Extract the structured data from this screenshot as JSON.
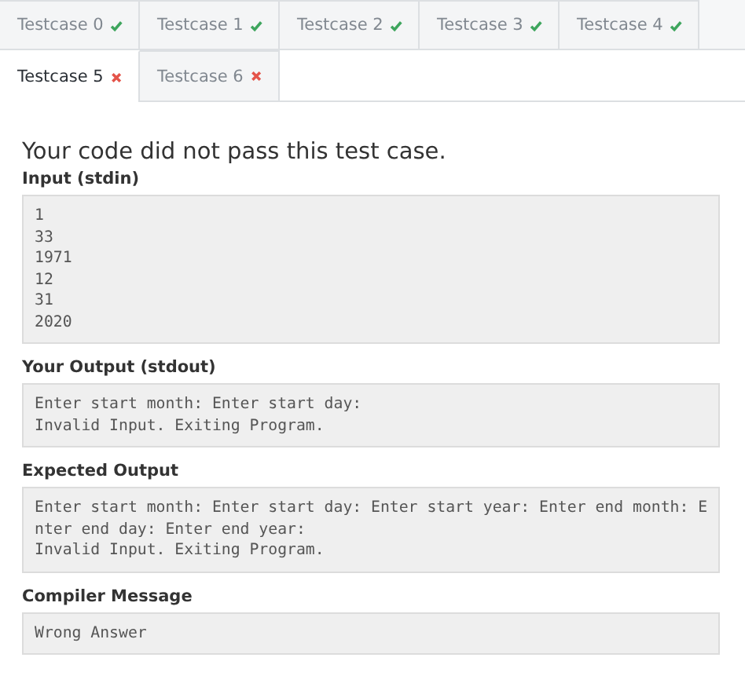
{
  "tabs": [
    {
      "label": "Testcase 0",
      "passed": true,
      "selected": false
    },
    {
      "label": "Testcase 1",
      "passed": true,
      "selected": false
    },
    {
      "label": "Testcase 2",
      "passed": true,
      "selected": false
    },
    {
      "label": "Testcase 3",
      "passed": true,
      "selected": false
    },
    {
      "label": "Testcase 4",
      "passed": true,
      "selected": false
    },
    {
      "label": "Testcase 5",
      "passed": false,
      "selected": true
    },
    {
      "label": "Testcase 6",
      "passed": false,
      "selected": false
    }
  ],
  "result_message": "Your code did not pass this test case.",
  "sections": [
    {
      "title": "Input (stdin)",
      "lines": [
        "1",
        "33",
        "1971",
        "12",
        "31",
        "2020"
      ]
    },
    {
      "title": "Your Output (stdout)",
      "lines": [
        "Enter start month: Enter start day:",
        "Invalid Input. Exiting Program."
      ]
    },
    {
      "title": "Expected Output",
      "lines": [
        "Enter start month: Enter start day: Enter start year: Enter end month: E",
        "nter end day: Enter end year:",
        "Invalid Input. Exiting Program."
      ]
    },
    {
      "title": "Compiler Message",
      "lines": [
        "Wrong Answer"
      ]
    }
  ]
}
